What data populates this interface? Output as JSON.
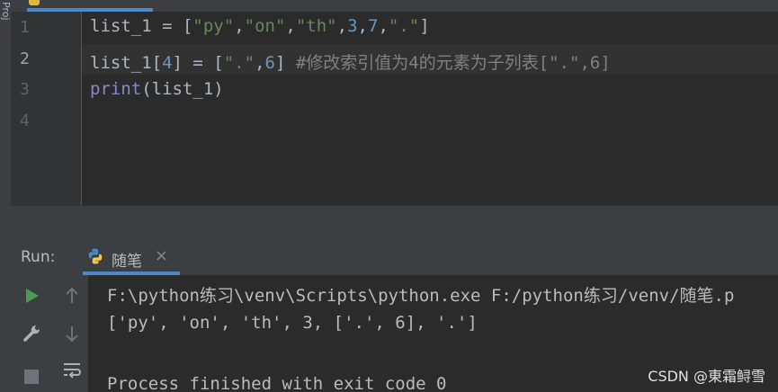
{
  "sidebar": {
    "vertical_label": "Proj"
  },
  "editor": {
    "line_numbers": [
      "1",
      "2",
      "3",
      "4"
    ],
    "line1": {
      "var": "list_1",
      "op": " = ",
      "open": "[",
      "s1": "\"py\"",
      "c1": ",",
      "s2": "\"on\"",
      "c2": ",",
      "s3": "\"th\"",
      "c3": ",",
      "n1": "3",
      "c4": ",",
      "n2": "7",
      "c5": ",",
      "s4": "\".\"",
      "close": "]"
    },
    "line2": {
      "var": "list_1[",
      "idx": "4",
      "mid": "] = [",
      "s1": "\".\"",
      "c1": ",",
      "n1": "6",
      "close": "] ",
      "comment": "#修改索引值为4的元素为子列表[\".\",6]"
    },
    "line3": {
      "fn": "print",
      "args": "(list_1)"
    }
  },
  "run_panel": {
    "label": "Run:",
    "tab_label": "随笔",
    "close_icon": "×",
    "console_lines": [
      "F:\\python练习\\venv\\Scripts\\python.exe F:/python练习/venv/随笔.p",
      "['py', 'on', 'th', 3, ['.', 6], '.']",
      "",
      "Process finished with exit code 0"
    ]
  },
  "watermark": "CSDN @東霜鲟雪",
  "colors": {
    "background": "#2b2b2b",
    "string": "#6a8759",
    "number": "#6897bb",
    "comment": "#808080",
    "builtin": "#8888c6",
    "accent": "#4a88c7"
  }
}
